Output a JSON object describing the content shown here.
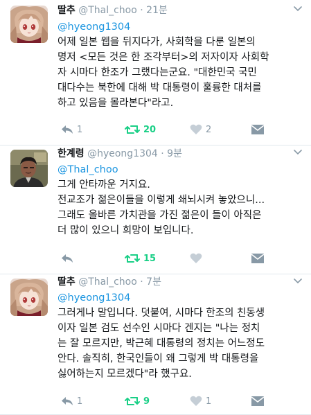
{
  "tweets": [
    {
      "name": "딸추",
      "handle": "@Thal_choo",
      "time": "· 21분",
      "mention": "@hyeong1304",
      "lines": [
        "어제 일본 웹을 뒤지다가, 사회학을 다룬 일본의",
        "명저 <모든 것은 한 조각부터>의 저자이자 사회학",
        "자 시마다 한조가 그랬다는군요. \"대한민국 국민",
        "대다수는 북한에 대해 박 대통령이 훌륭한 대처를",
        "하고 있음을 몰라본다\"라고."
      ],
      "reply_count": "1",
      "retweet_count": "20",
      "like_count": "2"
    },
    {
      "name": "한계령",
      "handle": "@hyeong1304",
      "time": "· 9분",
      "mention": "@Thal_choo",
      "lines": [
        "그게 안타까운 거지요.",
        "전교조가 젊은이들을 이렇게 쇄뇌시켜 놓았으니...",
        "그래도 올바른 가치관을 가진 젊은이 들이 아직은",
        "더 많이 있으니 희망이 보입니다."
      ],
      "reply_count": "",
      "retweet_count": "15",
      "like_count": ""
    },
    {
      "name": "딸추",
      "handle": "@Thal_choo",
      "time": "· 7분",
      "mention": "@hyeong1304",
      "lines": [
        "그러게나 말입니다. 덧붙여, 시마다 한조의 친동생",
        "이자 일본 검도 선수인 시마다 겐지는 \"나는 정치",
        "는 잘 모르지만, 박근혜 대통령의 정치는 어느정도",
        "안다. 솔직히, 한국인들이 왜 그렇게 박 대통령을",
        "싫어하는지 모르겠다\"라 했구요."
      ],
      "reply_count": "1",
      "retweet_count": "9",
      "like_count": "1"
    }
  ],
  "icons": {
    "reply": "reply-icon",
    "retweet": "retweet-icon",
    "like": "heart-icon",
    "dm": "direct-message-icon",
    "caret": "chevron-down-icon"
  },
  "colors": {
    "mention": "#1b95e0",
    "retweet_active": "#19cf86",
    "muted": "#8899a6",
    "divider": "#e1e8ed"
  }
}
